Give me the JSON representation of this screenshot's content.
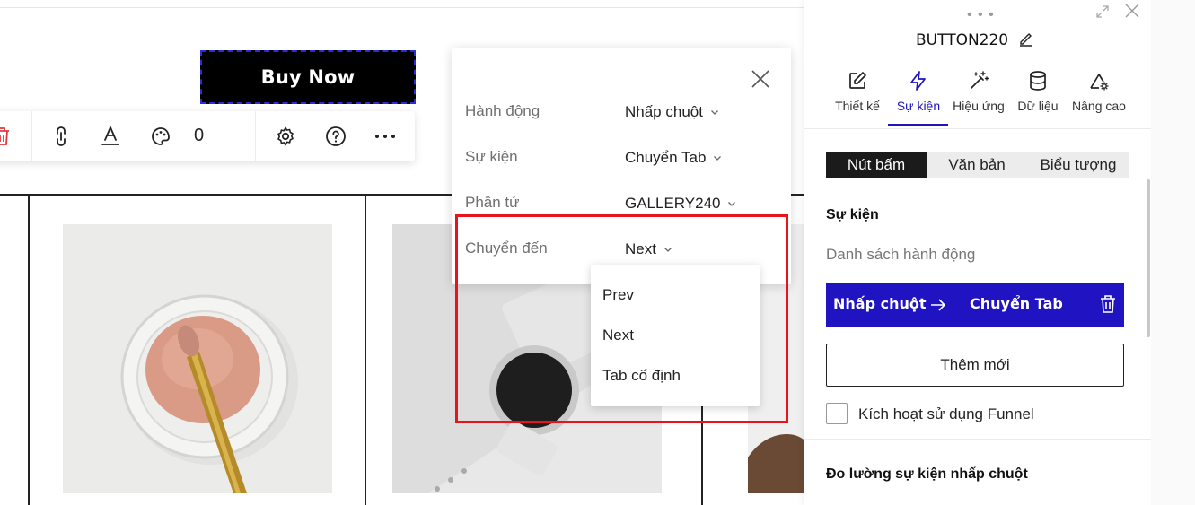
{
  "canvas": {
    "buy_button_label": "Buy Now",
    "toolbar": {
      "count": "0",
      "icons": [
        "trash-icon",
        "link-icon",
        "text-format-icon",
        "palette-icon",
        "gear-icon",
        "help-icon",
        "more-icon"
      ]
    }
  },
  "popup": {
    "rows": [
      {
        "label": "Hành động",
        "value": "Nhấp chuột"
      },
      {
        "label": "Sự kiện",
        "value": "Chuyển Tab"
      },
      {
        "label": "Phần tử",
        "value": "GALLERY240"
      },
      {
        "label": "Chuyển đến",
        "value": "Next"
      }
    ],
    "dropdown_options": [
      "Prev",
      "Next",
      "Tab cố định"
    ],
    "highlight_color": "#e8141b"
  },
  "panel": {
    "title": "BUTTON220",
    "tabs": [
      {
        "label": "Thiết kế",
        "icon": "pencil-square-icon"
      },
      {
        "label": "Sự kiện",
        "icon": "lightning-icon"
      },
      {
        "label": "Hiệu ứng",
        "icon": "magic-wand-icon"
      },
      {
        "label": "Dữ liệu",
        "icon": "database-icon"
      },
      {
        "label": "Nâng cao",
        "icon": "shapes-gear-icon"
      }
    ],
    "active_tab": "Sự kiện",
    "segments": [
      "Nút bấm",
      "Văn bản",
      "Biểu tượng"
    ],
    "active_segment": "Nút bấm",
    "section_title": "Sự kiện",
    "section_subtitle": "Danh sách hành động",
    "action": {
      "trigger": "Nhấp chuột",
      "event": "Chuyển Tab"
    },
    "add_new_label": "Thêm mới",
    "funnel_label": "Kích hoạt sử dụng Funnel",
    "measure_title": "Đo lường sự kiện nhấp chuột",
    "accent_color": "#1f13c2"
  }
}
